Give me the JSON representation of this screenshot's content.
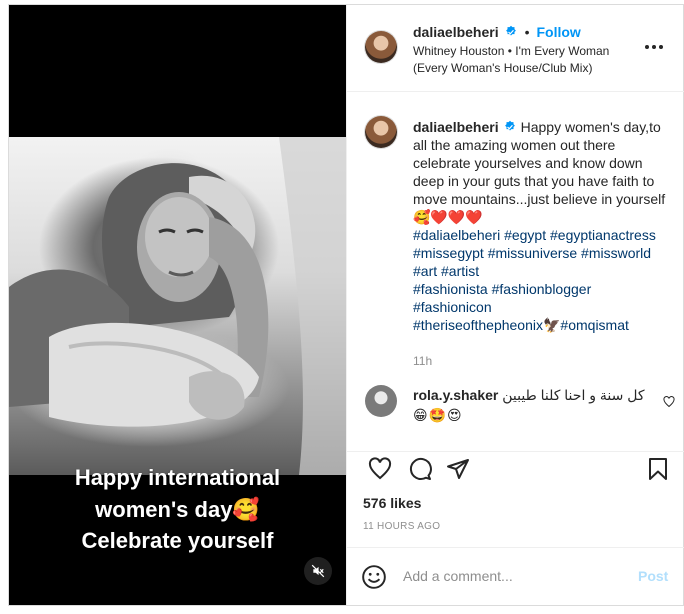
{
  "post": {
    "username": "daliaelbeheri",
    "follow_label": "Follow",
    "song": "Whitney Houston • I'm Every Woman (Every Woman's House/Club Mix)",
    "caption_text": "Happy women's day,to all the amazing women out there celebrate yourselves and know down deep in your guts that you have faith to move mountains...just believe in yourself",
    "caption_emojis": "🥰❤️❤️❤️",
    "hashtags": [
      "#daliaelbeheri",
      "#egypt",
      "#egyptianactress",
      "#missegypt",
      "#missuniverse",
      "#missworld",
      "#art",
      "#artist",
      "#fashionista",
      "#fashionblogger",
      "#fashionicon",
      "#theriseofthepheonix",
      "#omqismat"
    ],
    "tag_lines": [
      "#daliaelbeheri #egypt #egyptianactress",
      "#missegypt #missuniverse #missworld",
      "#art #artist",
      "#fashionista #fashionblogger",
      "#fashionicon",
      "#theriseofthepheonix🦅#omqismat"
    ],
    "time_short": "11h",
    "likes": "576 likes",
    "time_ago": "11 HOURS AGO"
  },
  "video": {
    "caption_line1": "Happy international",
    "caption_line2": "women's day🥰",
    "caption_line3": "Celebrate yourself"
  },
  "comment": {
    "username": "rola.y.shaker",
    "text": "كل سنة و احنا كلنا طيبين",
    "emojis": "😁🤩😍"
  },
  "composer": {
    "placeholder": "Add a comment...",
    "post_label": "Post"
  },
  "colors": {
    "accent": "#0095f6",
    "hashtag": "#00376b",
    "muted": "#8e8e8e",
    "post_disabled": "#b2dffc"
  },
  "icons": [
    "verified-badge-icon",
    "more-options-icon",
    "heart-icon",
    "comment-icon",
    "share-icon",
    "save-icon",
    "emoji-icon",
    "mute-icon"
  ]
}
